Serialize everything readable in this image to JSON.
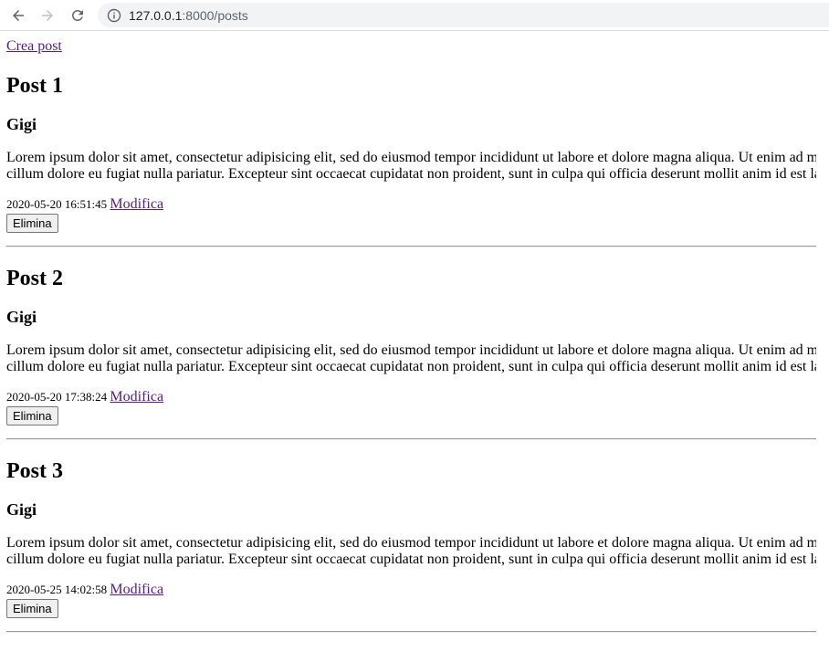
{
  "browser": {
    "url_host": "127.0.0.1",
    "url_rest": ":8000/posts"
  },
  "page": {
    "create_link": "Crea post"
  },
  "posts": [
    {
      "title": "Post 1",
      "author": "Gigi",
      "body_line1": "Lorem ipsum dolor sit amet, consectetur adipisicing elit, sed do eiusmod tempor incididunt ut labore et dolore magna aliqua. Ut enim ad m",
      "body_line2": "cillum dolore eu fugiat nulla pariatur. Excepteur sint occaecat cupidatat non proident, sunt in culpa qui officia deserunt mollit anim id est la",
      "timestamp": "2020-05-20 16:51:45",
      "edit_label": "Modifica",
      "delete_label": "Elimina"
    },
    {
      "title": "Post 2",
      "author": "Gigi",
      "body_line1": "Lorem ipsum dolor sit amet, consectetur adipisicing elit, sed do eiusmod tempor incididunt ut labore et dolore magna aliqua. Ut enim ad m",
      "body_line2": "cillum dolore eu fugiat nulla pariatur. Excepteur sint occaecat cupidatat non proident, sunt in culpa qui officia deserunt mollit anim id est la",
      "timestamp": "2020-05-20 17:38:24",
      "edit_label": "Modifica",
      "delete_label": "Elimina"
    },
    {
      "title": "Post 3",
      "author": "Gigi",
      "body_line1": "Lorem ipsum dolor sit amet, consectetur adipisicing elit, sed do eiusmod tempor incididunt ut labore et dolore magna aliqua. Ut enim ad m",
      "body_line2": "cillum dolore eu fugiat nulla pariatur. Excepteur sint occaecat cupidatat non proident, sunt in culpa qui officia deserunt mollit anim id est la",
      "timestamp": "2020-05-25 14:02:58",
      "edit_label": "Modifica",
      "delete_label": "Elimina"
    }
  ],
  "colors": {
    "link": "#551a8b",
    "omnibox_bg": "#f1f3f4"
  },
  "icons": [
    "back-arrow-icon",
    "forward-arrow-icon",
    "reload-icon",
    "info-icon"
  ]
}
